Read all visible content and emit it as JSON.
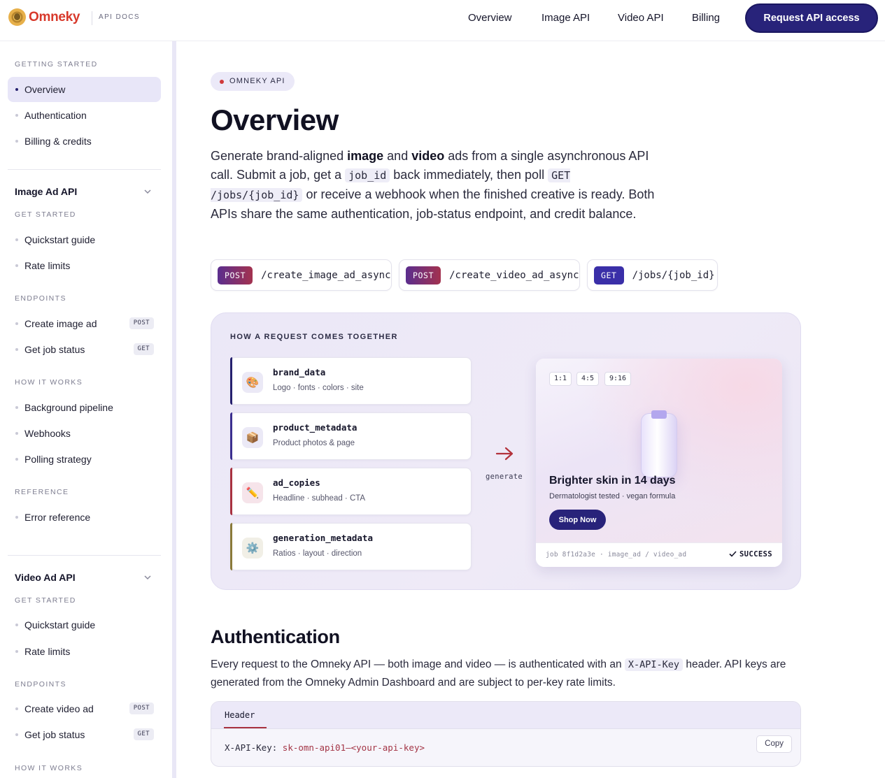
{
  "header": {
    "brand": "Omneky",
    "subtitle": "API DOCS",
    "nav": [
      "Overview",
      "Image API",
      "Video API",
      "Billing"
    ],
    "cta_label": "Request API access"
  },
  "sidebar": {
    "getting_started": {
      "section": "GETTING STARTED",
      "items": [
        "Overview",
        "Authentication",
        "Billing & credits"
      ],
      "active": "Overview"
    },
    "image_api": {
      "title": "Image Ad API",
      "get_started": "GET STARTED",
      "get_started_items": [
        "Quickstart guide",
        "Rate limits"
      ],
      "endpoints": "ENDPOINTS",
      "endpoint_items": [
        {
          "label": "Create image ad",
          "method": "POST"
        },
        {
          "label": "Get job status",
          "method": "GET"
        }
      ],
      "how_it_works": "HOW IT WORKS",
      "how_items": [
        "Background pipeline",
        "Webhooks",
        "Polling strategy"
      ],
      "reference": "REFERENCE",
      "reference_items": [
        "Error reference"
      ]
    },
    "video_api": {
      "title": "Video Ad API",
      "get_started": "GET STARTED",
      "get_started_items": [
        "Quickstart guide",
        "Rate limits"
      ],
      "endpoints": "ENDPOINTS",
      "endpoint_items": [
        {
          "label": "Create video ad",
          "method": "POST"
        },
        {
          "label": "Get job status",
          "method": "GET"
        }
      ],
      "how_it_works": "HOW IT WORKS"
    }
  },
  "main": {
    "pill": "OMNEKY API",
    "title": "Overview",
    "intro": {
      "p1": "Generate brand-aligned ",
      "b1": "image",
      "p2": " and ",
      "b2": "video",
      "p3": " ads from a single asynchronous API call. Submit a job, get a ",
      "c1": "job_id",
      "p4": " back immediately, then poll ",
      "c2": "GET /jobs/{job_id}",
      "p5": " or receive a webhook when the finished creative is ready. Both APIs share the same authentication, job-status endpoint, and credit balance."
    },
    "endpoints": [
      {
        "method": "POST",
        "path": "/create_image_ad_async"
      },
      {
        "method": "POST",
        "path": "/create_video_ad_async"
      },
      {
        "method": "GET",
        "path": "/jobs/{job_id}"
      }
    ]
  },
  "flow": {
    "title": "HOW A REQUEST COMES TOGETHER",
    "inputs": [
      {
        "name": "brand_data",
        "desc": "Logo · fonts · colors · site",
        "icon": "palette-icon",
        "glyph": "🎨",
        "color": "#26216e"
      },
      {
        "name": "product_metadata",
        "desc": "Product photos & page",
        "icon": "package-icon",
        "glyph": "📦",
        "color": "#3b2f8f"
      },
      {
        "name": "ad_copies",
        "desc": "Headline · subhead · CTA",
        "icon": "pencil-icon",
        "glyph": "✏️",
        "color": "#a83240"
      },
      {
        "name": "generation_metadata",
        "desc": "Ratios · layout · direction",
        "icon": "gear-icon",
        "glyph": "⚙️",
        "color": "#8a7a3a"
      }
    ],
    "arrow_label": "generate",
    "preview": {
      "ratios": [
        "1:1",
        "4:5",
        "9:16"
      ],
      "headline": "Brighter skin in 14 days",
      "subline": "Dermatologist tested · vegan formula",
      "button": "Shop Now",
      "job_text": "job 8f1d2a3e · image_ad / video_ad",
      "status": "SUCCESS"
    }
  },
  "auth": {
    "title": "Authentication",
    "p1": "Every request to the Omneky API — both image and video — is authenticated with an ",
    "code": "X-API-Key",
    "p2": " header. API keys are generated from the Omneky Admin Dashboard and are subject to per-key rate limits.",
    "tab": "Header",
    "key_label": "X-API-Key:",
    "key_value": "sk-omn-api01—<your-api-key>",
    "copy": "Copy"
  },
  "colors": {
    "accent": "#28237a",
    "brand_red": "#d8392b",
    "post_gradient": [
      "#5b2e8e",
      "#a3324f"
    ],
    "get": "#3a2fa8"
  }
}
